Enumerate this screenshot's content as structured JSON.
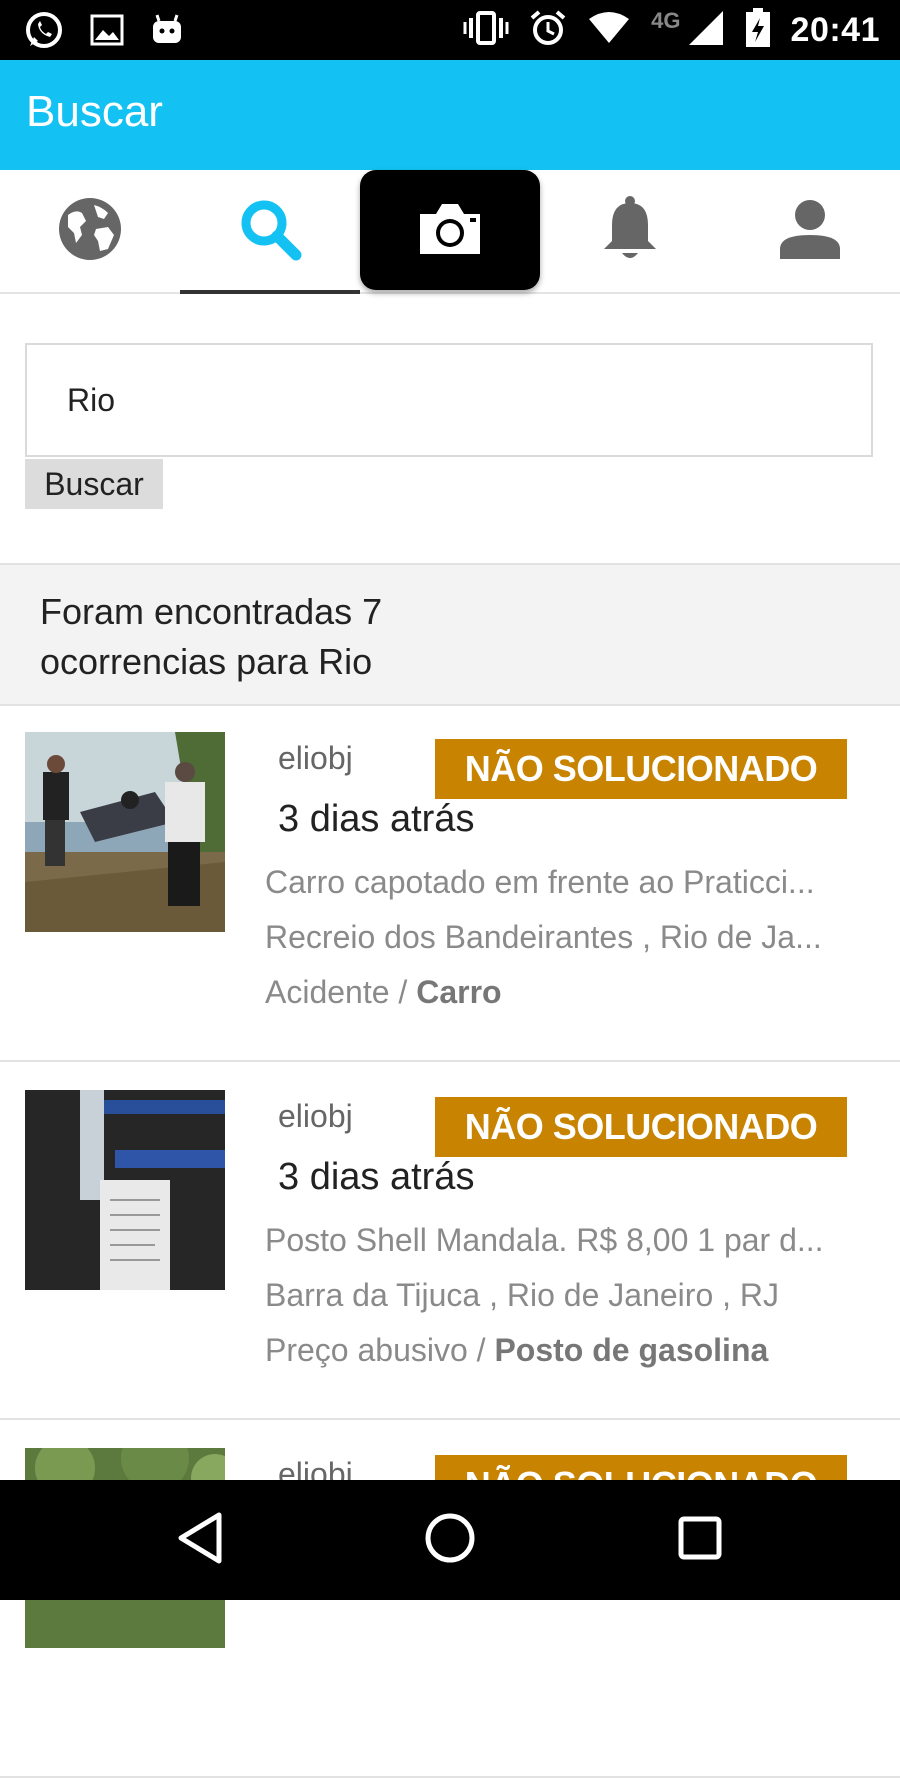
{
  "statusbar": {
    "time": "20:41",
    "network": "4G",
    "icons": [
      "whatsapp-icon",
      "gallery-icon",
      "android-icon",
      "vibrate-icon",
      "alarm-icon",
      "wifi-icon",
      "signal-icon",
      "battery-icon"
    ]
  },
  "appbar": {
    "title": "Buscar"
  },
  "tabs": [
    {
      "name": "explore",
      "icon": "globe-icon"
    },
    {
      "name": "search",
      "icon": "search-icon",
      "active": true
    },
    {
      "name": "camera",
      "icon": "camera-icon"
    },
    {
      "name": "notifications",
      "icon": "bell-icon"
    },
    {
      "name": "profile",
      "icon": "person-icon"
    }
  ],
  "search": {
    "value": "Rio",
    "button_label": "Buscar"
  },
  "results": {
    "summary": "Foram encontradas 7 ocorrencias para Rio"
  },
  "items": [
    {
      "user": "eliobj",
      "status": "NÃO SOLUCIONADO",
      "time": "3 dias atrás",
      "description": "Carro capotado em frente ao Praticci...",
      "location": "Recreio dos Bandeirantes , Rio de Ja...",
      "category": "Acidente / ",
      "subcategory": "Carro"
    },
    {
      "user": "eliobj",
      "status": "NÃO SOLUCIONADO",
      "time": "3 dias atrás",
      "description": "Posto Shell Mandala. R$ 8,00 1 par d...",
      "location": "Barra da Tijuca , Rio de Janeiro , RJ",
      "category": "Preço abusivo / ",
      "subcategory": "Posto de gasolina"
    },
    {
      "user": "eliobj",
      "status": "NÃO SOLUCIONADO"
    }
  ],
  "colors": {
    "appbar": "#13C2F2",
    "badge": "#C88300",
    "active_tab": "#13C2F2",
    "inactive_tab": "#666666"
  }
}
